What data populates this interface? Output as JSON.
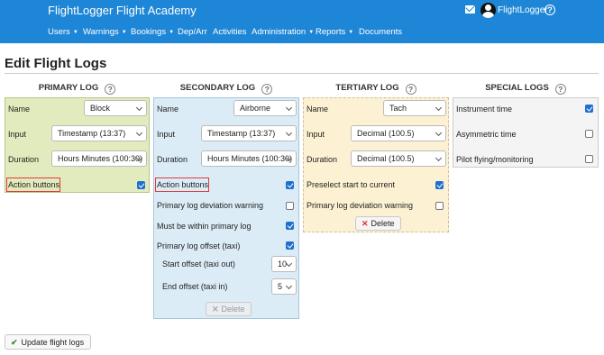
{
  "header": {
    "brand": "FlightLogger Flight Academy",
    "username": "FlightLogger",
    "help_glyph": "?"
  },
  "nav": [
    {
      "label": "Users",
      "dropdown": true
    },
    {
      "label": "Warnings",
      "dropdown": true
    },
    {
      "label": "Bookings",
      "dropdown": true
    },
    {
      "label": "Dep/Arr",
      "dropdown": false
    },
    {
      "label": "Activities",
      "dropdown": false
    },
    {
      "label": "Administration",
      "dropdown": true
    },
    {
      "label": "Reports",
      "dropdown": true
    },
    {
      "label": "Documents",
      "dropdown": false
    }
  ],
  "page": {
    "title": "Edit Flight Logs"
  },
  "columns": {
    "primary": {
      "heading": "PRIMARY LOG",
      "name_label": "Name",
      "name_value": "Block",
      "input_label": "Input",
      "input_value": "Timestamp (13:37)",
      "duration_label": "Duration",
      "duration_value": "Hours Minutes (100:30)",
      "action_buttons_label": "Action buttons",
      "action_buttons_checked": true
    },
    "secondary": {
      "heading": "SECONDARY LOG",
      "name_label": "Name",
      "name_value": "Airborne",
      "input_label": "Input",
      "input_value": "Timestamp (13:37)",
      "duration_label": "Duration",
      "duration_value": "Hours Minutes (100:30)",
      "action_buttons_label": "Action buttons",
      "action_buttons_checked": true,
      "deviation_label": "Primary log deviation warning",
      "deviation_checked": false,
      "within_label": "Must be within primary log",
      "within_checked": true,
      "offset_label": "Primary log offset (taxi)",
      "offset_checked": true,
      "start_offset_label": "Start offset (taxi out)",
      "start_offset_value": "10",
      "end_offset_label": "End offset (taxi in)",
      "end_offset_value": "5",
      "delete_label": "Delete"
    },
    "tertiary": {
      "heading": "TERTIARY LOG",
      "name_label": "Name",
      "name_value": "Tach",
      "input_label": "Input",
      "input_value": "Decimal (100.5)",
      "duration_label": "Duration",
      "duration_value": "Decimal (100.5)",
      "preselect_label": "Preselect start to current",
      "preselect_checked": true,
      "deviation_label": "Primary log deviation warning",
      "deviation_checked": false,
      "delete_label": "Delete"
    },
    "special": {
      "heading": "SPECIAL LOGS",
      "items": [
        {
          "label": "Instrument time",
          "checked": true
        },
        {
          "label": "Asymmetric time",
          "checked": false
        },
        {
          "label": "Pilot flying/monitoring",
          "checked": false
        }
      ]
    }
  },
  "footer": {
    "update_label": "Update flight logs"
  },
  "colors": {
    "navbar": "#1e86d6",
    "highlight": "#e03a3a",
    "checkbox": "#1e6fd0"
  }
}
